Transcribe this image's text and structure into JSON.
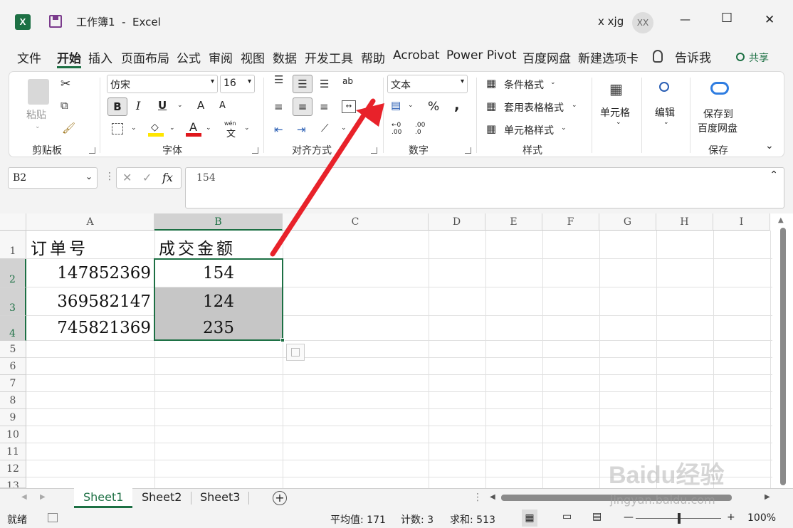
{
  "titlebar": {
    "app_icon": "excel-icon",
    "save_icon": "save-icon",
    "title": "工作簿1  -  Excel",
    "user_name": "x xjg",
    "avatar_text": "XX",
    "minimize": "—",
    "maximize": "☐",
    "close": "✕"
  },
  "menu": {
    "items": [
      "文件",
      "开始",
      "插入",
      "页面布局",
      "公式",
      "审阅",
      "视图",
      "数据",
      "开发工具",
      "帮助",
      "Acrobat",
      "Power Pivot",
      "百度网盘",
      "新建选项卡"
    ],
    "active": "开始",
    "tell_me": "告诉我",
    "share": "共享"
  },
  "ribbon": {
    "clipboard": {
      "paste": "粘贴",
      "label": "剪贴板"
    },
    "font": {
      "name": "仿宋",
      "size": "16",
      "bold": "B",
      "italic": "I",
      "underline": "U",
      "grow": "A",
      "shrink": "A",
      "font_color_letter": "A",
      "wen": "wén",
      "wen_char": "文",
      "label": "字体"
    },
    "alignment": {
      "label": "对齐方式",
      "wrap_glyph": "ab"
    },
    "number": {
      "format": "文本",
      "percent": "%",
      "comma": ",",
      "label": "数字",
      "inc": ".00",
      "dec": ".0"
    },
    "styles": {
      "conditional": "条件格式",
      "table": "套用表格格式",
      "cell_styles": "单元格样式",
      "label": "样式"
    },
    "cells": {
      "label": "单元格"
    },
    "editing": {
      "label": "编辑"
    },
    "save": {
      "line1": "保存到",
      "line2": "百度网盘",
      "label": "保存"
    }
  },
  "formula_bar": {
    "name_box": "B2",
    "fx": "fx",
    "content": "154"
  },
  "sheet": {
    "columns": [
      "A",
      "B",
      "C",
      "D",
      "E",
      "F",
      "G",
      "H",
      "I"
    ],
    "rows": [
      "1",
      "2",
      "3",
      "4",
      "5",
      "6",
      "7",
      "8",
      "9",
      "10",
      "11",
      "12",
      "13"
    ],
    "cells": {
      "A1": "订单号",
      "B1": "成交金额",
      "A2": "147852369",
      "B2": "154",
      "A3": "369582147",
      "B3": "124",
      "A4": "745821369",
      "B4": "235"
    }
  },
  "tabs": [
    "Sheet1",
    "Sheet2",
    "Sheet3"
  ],
  "active_tab": "Sheet1",
  "add_sheet": "+",
  "status": {
    "ready": "就绪",
    "average": "平均值: 171",
    "count": "计数: 3",
    "sum": "求和: 513",
    "zoom": "100%",
    "zoom_minus": "—",
    "zoom_plus": "+"
  },
  "watermark": {
    "brand": "Baidu经验",
    "url": "jingyan.baidu.com"
  },
  "colors": {
    "excel_green": "#1d7044",
    "selection_gray": "#c6c6c6",
    "arrow_red": "#e8222a",
    "font_color_red": "#e0171c",
    "highlight_yellow": "#ffe600"
  }
}
